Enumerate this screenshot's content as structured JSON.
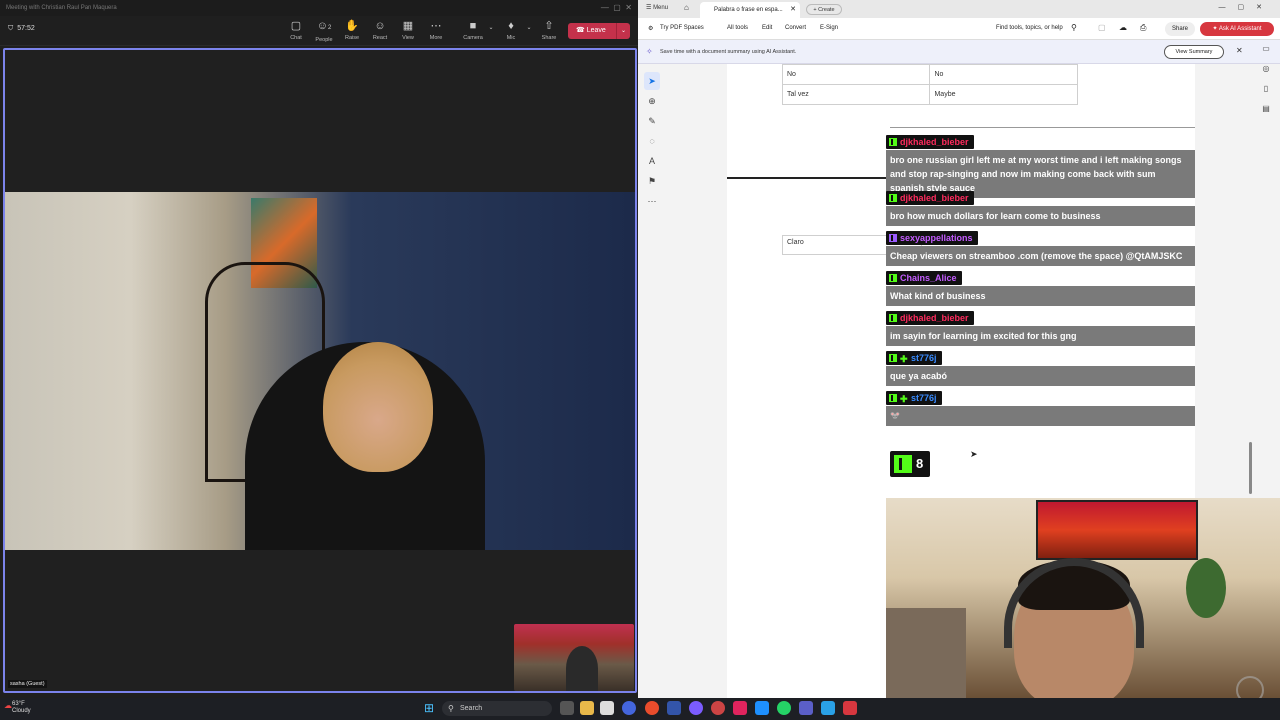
{
  "teams": {
    "title": "Meeting with Christian Raul Pan Maquera",
    "timer": "57:52",
    "toolbar": [
      {
        "label": "Chat",
        "icon": "chat-icon",
        "glyph": "▢"
      },
      {
        "label": "People",
        "icon": "people-icon",
        "glyph": "☺"
      },
      {
        "label": "Raise",
        "icon": "raise-hand-icon",
        "glyph": "✋"
      },
      {
        "label": "React",
        "icon": "react-icon",
        "glyph": "☺"
      },
      {
        "label": "View",
        "icon": "view-icon",
        "glyph": "▦"
      },
      {
        "label": "More",
        "icon": "more-icon",
        "glyph": "⋯"
      },
      {
        "label": "Camera",
        "icon": "camera-icon",
        "glyph": "■"
      },
      {
        "label": "Mic",
        "icon": "mic-icon",
        "glyph": "♦"
      },
      {
        "label": "Share",
        "icon": "share-icon",
        "glyph": "⇧"
      }
    ],
    "people_count": "2",
    "leave_label": "Leave",
    "participant_name": "sasha (Guest)",
    "accent_color": "#7b83eb",
    "leave_color": "#c4314b"
  },
  "acrobat": {
    "menu_label": "Menu",
    "tab_title": "Palabra o frase en espa...",
    "create_label": "Create",
    "toolbar": {
      "try_pdf_spaces": "Try PDF Spaces",
      "all_tools": "All tools",
      "edit": "Edit",
      "convert": "Convert",
      "esign": "E-Sign",
      "find_placeholder": "Find tools, topics, or help",
      "share": "Share",
      "ask_ai": "Ask AI Assistant"
    },
    "ai_banner": {
      "text": "Save time with a document summary using AI Assistant.",
      "button": "View Summary"
    },
    "table_rows": [
      [
        "No",
        "No"
      ],
      [
        "Tal vez",
        "Maybe"
      ]
    ],
    "claro_cell": "Claro"
  },
  "chat": {
    "messages": [
      {
        "user": "djkhaled_bieber",
        "color": "#ff2b5e",
        "badge": "kick",
        "text": "bro one russian girl left me at my worst time and i left making songs and stop rap-singing and now im making come back with sum spanish style sauce"
      },
      {
        "user": "djkhaled_bieber",
        "color": "#ff2b5e",
        "badge": "kick",
        "text": "bro how much dollars for learn come to business"
      },
      {
        "user": "sexyappellations",
        "color": "#c45cff",
        "badge": "sub",
        "text": "Cheap viewers on streamboo .com (remove the space) @QtAMJSKC"
      },
      {
        "user": "Chains_Alice",
        "color": "#c45cff",
        "badge": "kick",
        "text": "What kind of business"
      },
      {
        "user": "djkhaled_bieber",
        "color": "#ff2b5e",
        "badge": "kick",
        "text": "im sayin for learning im excited for this gng"
      },
      {
        "user": "st776j",
        "color": "#3a8cff",
        "badge": "kick+",
        "text": "que ya acabó"
      },
      {
        "user": "st776j",
        "color": "#3a8cff",
        "badge": "kick+",
        "text": "🐭"
      }
    ],
    "viewer_count": "8",
    "kick_color": "#53fc18"
  },
  "taskbar": {
    "weather_temp": "63°F",
    "weather_desc": "Cloudy",
    "search_label": "Search"
  }
}
